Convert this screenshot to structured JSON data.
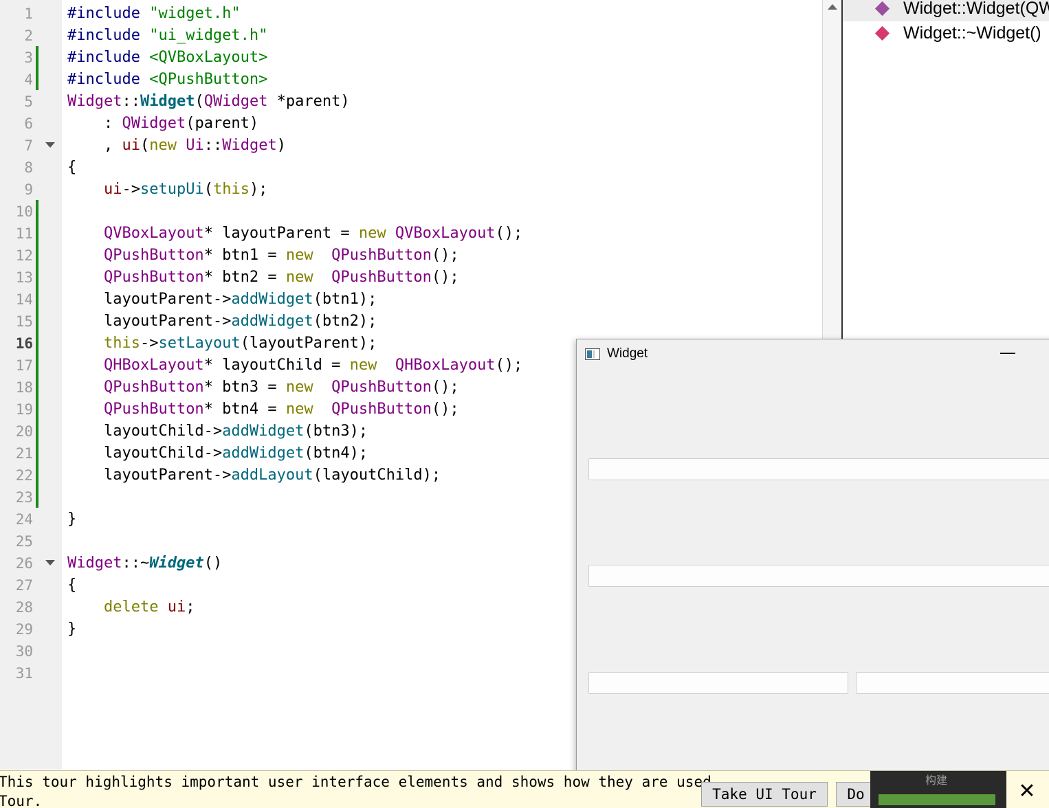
{
  "editor": {
    "line_numbers": [
      "1",
      "2",
      "3",
      "4",
      "5",
      "6",
      "7",
      "8",
      "9",
      "10",
      "11",
      "12",
      "13",
      "14",
      "15",
      "16",
      "17",
      "18",
      "19",
      "20",
      "21",
      "22",
      "23",
      "24",
      "25",
      "26",
      "27",
      "28",
      "29",
      "30",
      "31"
    ],
    "current_line": "16",
    "code": {
      "l1": {
        "a": "#include ",
        "b": "\"widget.h\""
      },
      "l2": {
        "a": "#include ",
        "b": "\"ui_widget.h\""
      },
      "l3": {
        "a": "#include ",
        "b": "<QVBoxLayout>"
      },
      "l4": {
        "a": "#include ",
        "b": "<QPushButton>"
      },
      "l5": {
        "a": "Widget",
        "b": "::",
        "c": "Widget",
        "d": "(",
        "e": "QWidget",
        "f": " *parent)"
      },
      "l6": {
        "a": "    : ",
        "b": "QWidget",
        "c": "(parent)"
      },
      "l7": {
        "a": "    , ",
        "b": "ui",
        "c": "(",
        "d": "new",
        "e": " Ui",
        "f": "::",
        "g": "Widget",
        "h": ")"
      },
      "l8": {
        "a": "{"
      },
      "l9": {
        "a": "    ",
        "b": "ui",
        "c": "->",
        "d": "setupUi",
        "e": "(",
        "f": "this",
        "g": ");"
      },
      "l11": {
        "a": "    ",
        "b": "QVBoxLayout",
        "c": "* layoutParent = ",
        "d": "new",
        "e": " ",
        "f": "QVBoxLayout",
        "g": "();"
      },
      "l12": {
        "a": "    ",
        "b": "QPushButton",
        "c": "* btn1 = ",
        "d": "new",
        "e": "  ",
        "f": "QPushButton",
        "g": "();"
      },
      "l13": {
        "a": "    ",
        "b": "QPushButton",
        "c": "* btn2 = ",
        "d": "new",
        "e": "  ",
        "f": "QPushButton",
        "g": "();"
      },
      "l14": {
        "a": "    layoutParent->",
        "b": "addWidget",
        "c": "(btn1);"
      },
      "l15": {
        "a": "    layoutParent->",
        "b": "addWidget",
        "c": "(btn2);"
      },
      "l16": {
        "a": "    ",
        "b": "this",
        "c": "->",
        "d": "setLayout",
        "e": "(layoutParent);"
      },
      "l17": {
        "a": "    ",
        "b": "QHBoxLayout",
        "c": "* layoutChild = ",
        "d": "new",
        "e": "  ",
        "f": "QHBoxLayout",
        "g": "();"
      },
      "l18": {
        "a": "    ",
        "b": "QPushButton",
        "c": "* btn3 = ",
        "d": "new",
        "e": "  ",
        "f": "QPushButton",
        "g": "();"
      },
      "l19": {
        "a": "    ",
        "b": "QPushButton",
        "c": "* btn4 = ",
        "d": "new",
        "e": "  ",
        "f": "QPushButton",
        "g": "();"
      },
      "l20": {
        "a": "    layoutChild->",
        "b": "addWidget",
        "c": "(btn3);"
      },
      "l21": {
        "a": "    layoutChild->",
        "b": "addWidget",
        "c": "(btn4);"
      },
      "l22": {
        "a": "    layoutParent->",
        "b": "addLayout",
        "c": "(layoutChild);"
      },
      "l24": {
        "a": "}"
      },
      "l26": {
        "a": "Widget",
        "b": "::~",
        "c": "Widget",
        "d": "()"
      },
      "l27": {
        "a": "{"
      },
      "l28": {
        "a": "    ",
        "b": "delete",
        "c": " ",
        "d": "ui",
        "e": ";"
      },
      "l29": {
        "a": "}"
      }
    }
  },
  "outline": {
    "items": [
      {
        "label": "Widget::Widget(QWidget *parent)",
        "color": "#9b4f9e"
      },
      {
        "label": "Widget::~Widget()",
        "color": "#d63a6c"
      }
    ]
  },
  "widget_window": {
    "title": "Widget",
    "minimize": "—"
  },
  "tour": {
    "line1": "This tour highlights important user interface elements and shows how they are used.",
    "line2": "Tour.",
    "take_tour": "Take UI Tour",
    "do_not_show": "Do",
    "build_label": "构建",
    "build_progress": 1.0,
    "close": "✕"
  }
}
